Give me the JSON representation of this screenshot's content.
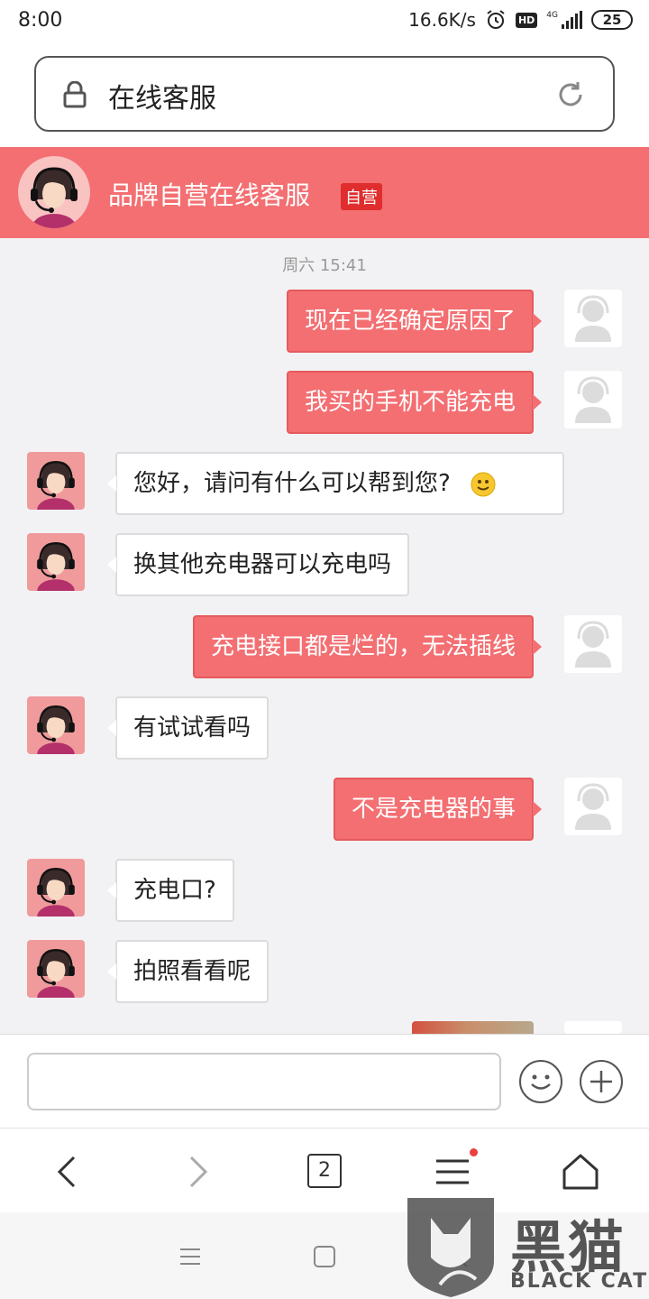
{
  "status_bar": {
    "time": "8:00",
    "net_speed": "16.6K/s",
    "network": "4G",
    "battery": "25"
  },
  "url_bar": {
    "title": "在线客服"
  },
  "chat_header": {
    "title": "品牌自营在线客服",
    "badge": "自营"
  },
  "chat": {
    "timestamp": "周六 15:41",
    "messages": [
      {
        "from": "user",
        "text": "现在已经确定原因了"
      },
      {
        "from": "user",
        "text": "我买的手机不能充电"
      },
      {
        "from": "agent",
        "text": "您好，请问有什么可以帮到您?",
        "emoji": "smiley-emoji"
      },
      {
        "from": "agent",
        "text": "换其他充电器可以充电吗"
      },
      {
        "from": "user",
        "text": "充电接口都是烂的，无法插线"
      },
      {
        "from": "agent",
        "text": "有试试看吗"
      },
      {
        "from": "user",
        "text": "不是充电器的事"
      },
      {
        "from": "agent",
        "text": "充电口?"
      },
      {
        "from": "agent",
        "text": "拍照看看呢"
      }
    ]
  },
  "input": {
    "placeholder": ""
  },
  "browser_nav": {
    "tab_count": "2"
  },
  "watermark": {
    "title": "黑猫",
    "subtitle": "BLACK CAT"
  },
  "colors": {
    "accent": "#f36f72",
    "badge_red": "#e02d2d"
  }
}
